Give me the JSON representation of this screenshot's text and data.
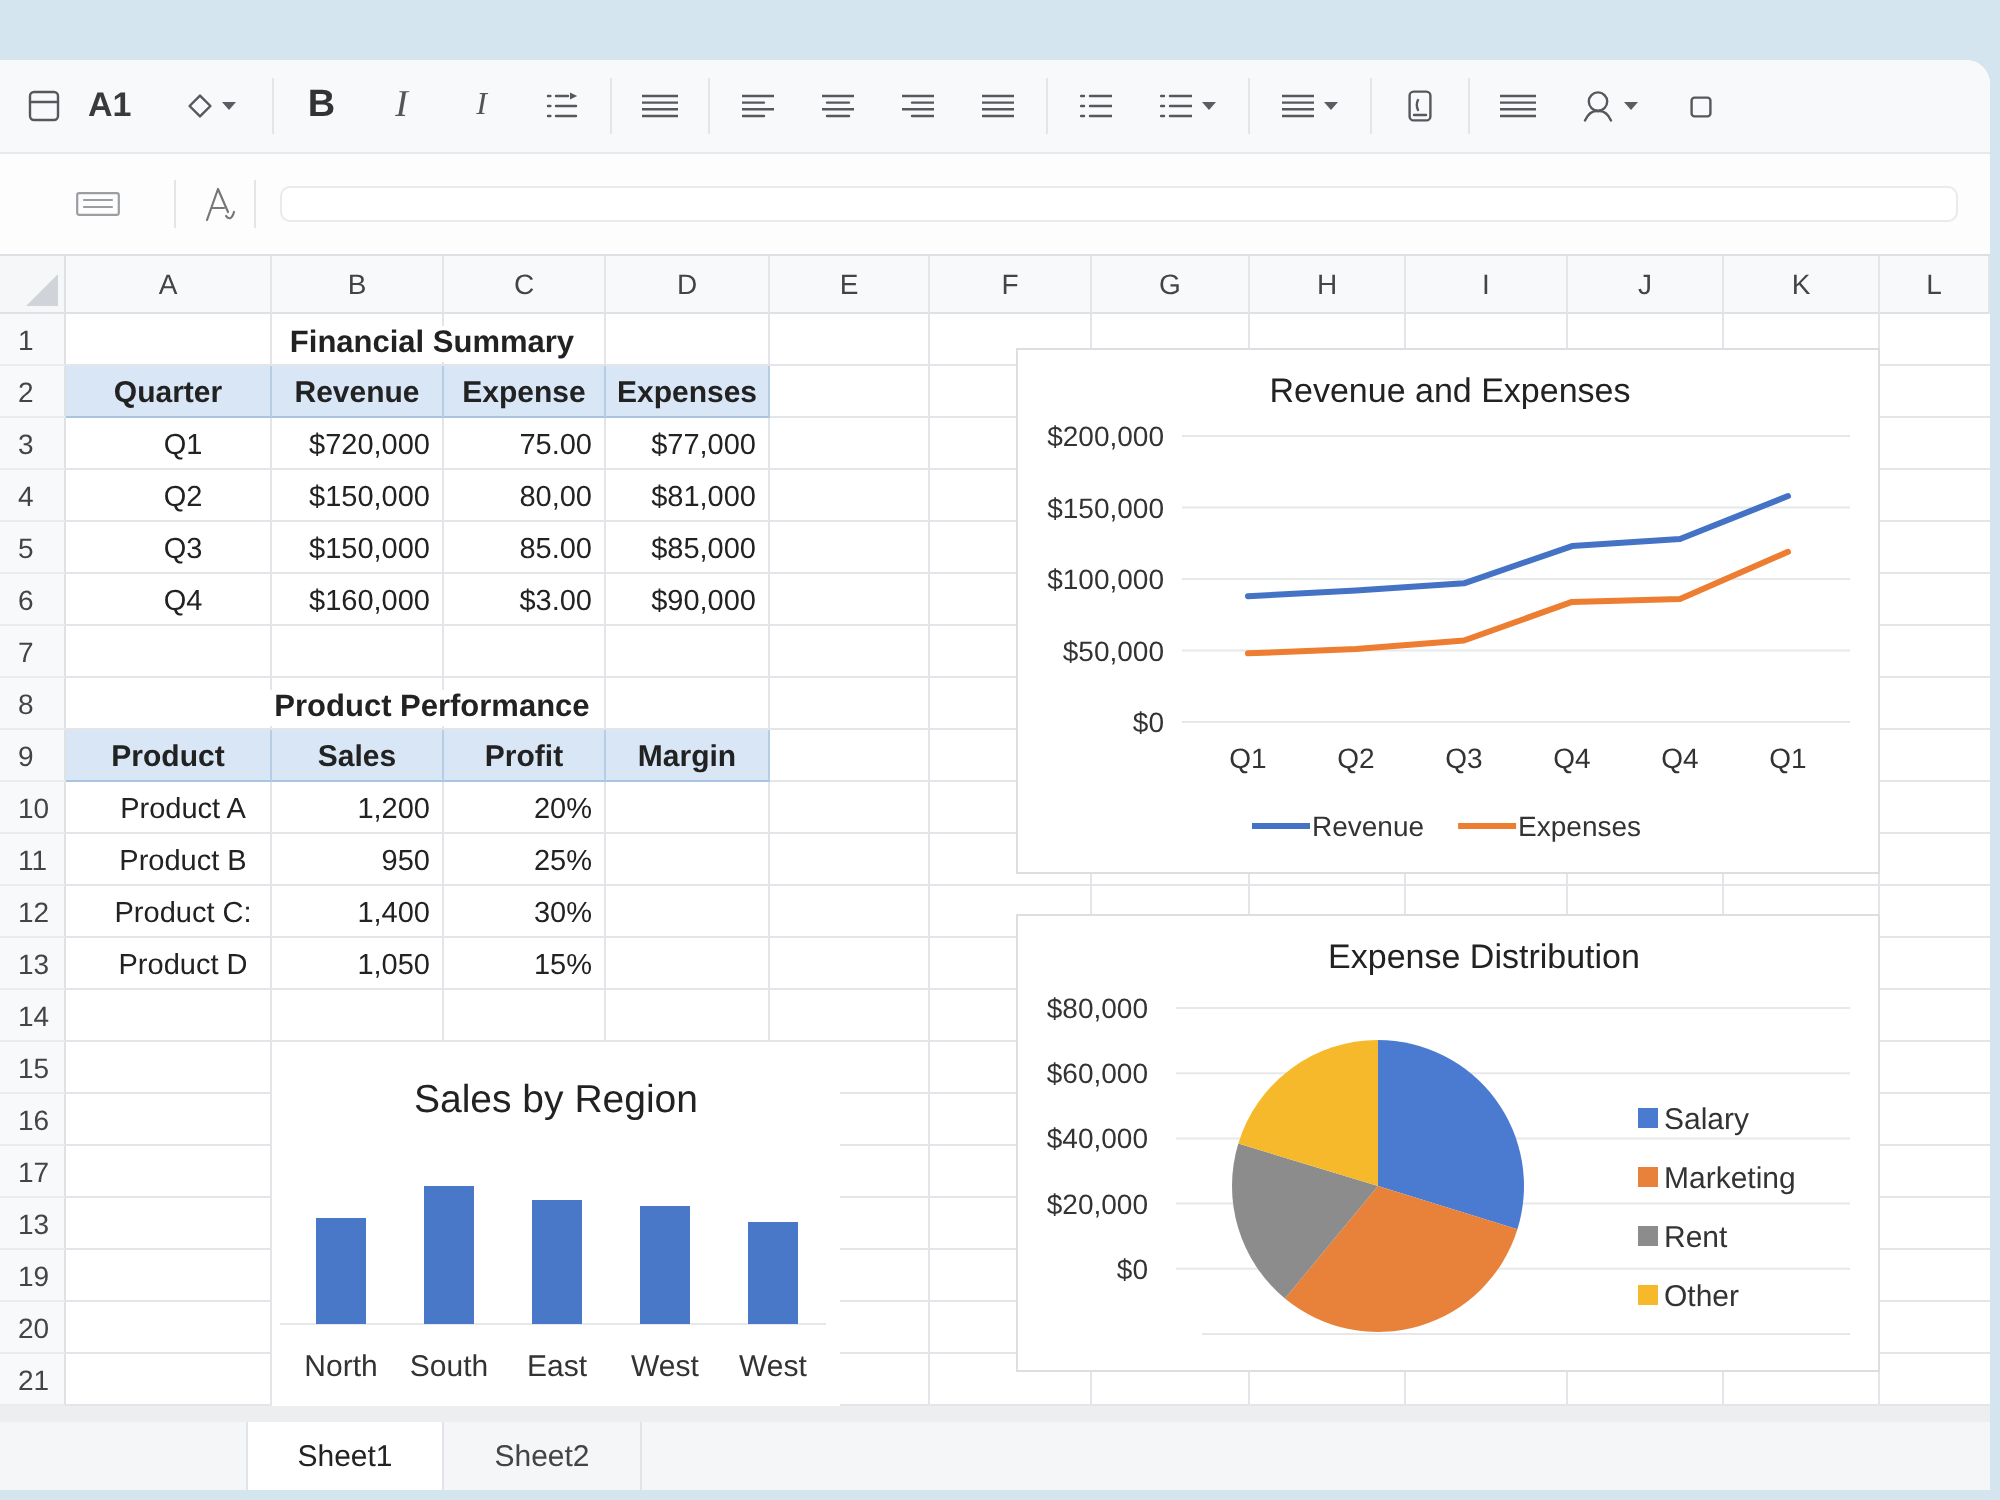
{
  "name_box": "A1",
  "toolbar": {
    "format_buttons": [
      "B",
      "I",
      "I"
    ]
  },
  "sheet": {
    "columns": [
      "A",
      "B",
      "C",
      "D",
      "E",
      "F",
      "G",
      "H",
      "I",
      "J",
      "K",
      "L"
    ],
    "rows": [
      "1",
      "2",
      "3",
      "4",
      "5",
      "6",
      "7",
      "8",
      "9",
      "10",
      "11",
      "12",
      "13",
      "14",
      "15",
      "16",
      "17",
      "13",
      "19",
      "20",
      "21"
    ],
    "tables": [
      {
        "title": "Financial Summary",
        "columns": [
          "Quarter",
          "Revenue",
          "Expense",
          "Expenses"
        ],
        "rows": [
          [
            "Q1",
            "$720,000",
            "75.00",
            "$77,000"
          ],
          [
            "Q2",
            "$150,000",
            "80,00",
            "$81,000"
          ],
          [
            "Q3",
            "$150,000",
            "85.00",
            "$85,000"
          ],
          [
            "Q4",
            "$160,000",
            "$3.00",
            "$90,000"
          ]
        ]
      },
      {
        "title": "Product Performance",
        "columns": [
          "Product",
          "Sales",
          "Profit",
          "Margin"
        ],
        "rows": [
          [
            "Product A",
            "1,200",
            "20%"
          ],
          [
            "Product B",
            "950",
            "25%"
          ],
          [
            "Product C:",
            "1,400",
            "30%"
          ],
          [
            "Product D",
            "1,050",
            "15%"
          ]
        ]
      }
    ]
  },
  "revenue_chart": {
    "chart_data": {
      "type": "line",
      "title": "Revenue and Expenses",
      "categories": [
        "Q1",
        "Q2",
        "Q3",
        "Q4",
        "Q4",
        "Q1"
      ],
      "series": [
        {
          "name": "Revenue",
          "color": "#4472c4",
          "values": [
            88000,
            92000,
            97000,
            123000,
            128000,
            158000
          ]
        },
        {
          "name": "Expenses",
          "color": "#ed7d31",
          "values": [
            48000,
            51000,
            57000,
            84000,
            86000,
            119000
          ]
        }
      ],
      "ylim": [
        0,
        200000
      ],
      "yticks": [
        {
          "value": 0,
          "label": "$0"
        },
        {
          "value": 50000,
          "label": "$50,000"
        },
        {
          "value": 100000,
          "label": "$100,000"
        },
        {
          "value": 150000,
          "label": "$150,000"
        },
        {
          "value": 200000,
          "label": "$200,000"
        }
      ],
      "grid": true,
      "legend": true
    }
  },
  "expense_chart": {
    "title": "Expense Distribution",
    "axis_labels": [
      "$80,000",
      "$60,000",
      "$40,000",
      "$20,000",
      "$0"
    ],
    "legend": [
      {
        "label": "Salary",
        "color": "#4a7bd0"
      },
      {
        "label": "Marketing",
        "color": "#e8823a"
      },
      {
        "label": "Rent",
        "color": "#8c8c8c"
      },
      {
        "label": "Other",
        "color": "#f6b92b"
      }
    ]
  },
  "sales_chart": {
    "title": "Sales by Region",
    "categories": [
      "North",
      "South",
      "East",
      "West",
      "West"
    ]
  },
  "sheet_tabs": [
    {
      "label": "Sheet1",
      "selected": true
    },
    {
      "label": "Sheet2",
      "selected": false
    }
  ]
}
